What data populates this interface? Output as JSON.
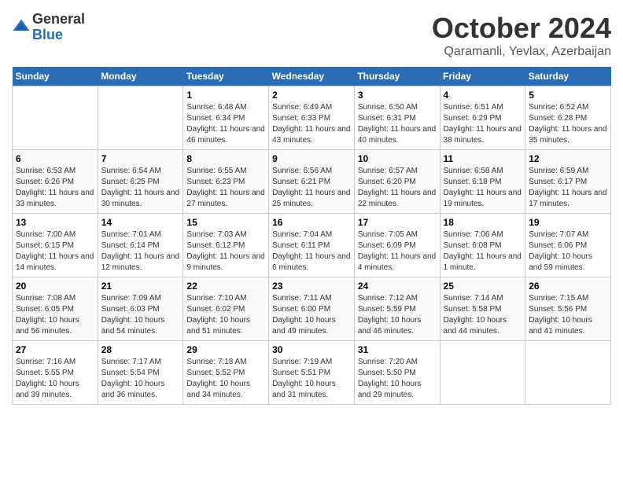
{
  "header": {
    "logo_line1": "General",
    "logo_line2": "Blue",
    "title": "October 2024",
    "subtitle": "Qaramanli, Yevlax, Azerbaijan"
  },
  "days_of_week": [
    "Sunday",
    "Monday",
    "Tuesday",
    "Wednesday",
    "Thursday",
    "Friday",
    "Saturday"
  ],
  "weeks": [
    [
      {
        "num": "",
        "info": ""
      },
      {
        "num": "",
        "info": ""
      },
      {
        "num": "1",
        "info": "Sunrise: 6:48 AM\nSunset: 6:34 PM\nDaylight: 11 hours and 46 minutes."
      },
      {
        "num": "2",
        "info": "Sunrise: 6:49 AM\nSunset: 6:33 PM\nDaylight: 11 hours and 43 minutes."
      },
      {
        "num": "3",
        "info": "Sunrise: 6:50 AM\nSunset: 6:31 PM\nDaylight: 11 hours and 40 minutes."
      },
      {
        "num": "4",
        "info": "Sunrise: 6:51 AM\nSunset: 6:29 PM\nDaylight: 11 hours and 38 minutes."
      },
      {
        "num": "5",
        "info": "Sunrise: 6:52 AM\nSunset: 6:28 PM\nDaylight: 11 hours and 35 minutes."
      }
    ],
    [
      {
        "num": "6",
        "info": "Sunrise: 6:53 AM\nSunset: 6:26 PM\nDaylight: 11 hours and 33 minutes."
      },
      {
        "num": "7",
        "info": "Sunrise: 6:54 AM\nSunset: 6:25 PM\nDaylight: 11 hours and 30 minutes."
      },
      {
        "num": "8",
        "info": "Sunrise: 6:55 AM\nSunset: 6:23 PM\nDaylight: 11 hours and 27 minutes."
      },
      {
        "num": "9",
        "info": "Sunrise: 6:56 AM\nSunset: 6:21 PM\nDaylight: 11 hours and 25 minutes."
      },
      {
        "num": "10",
        "info": "Sunrise: 6:57 AM\nSunset: 6:20 PM\nDaylight: 11 hours and 22 minutes."
      },
      {
        "num": "11",
        "info": "Sunrise: 6:58 AM\nSunset: 6:18 PM\nDaylight: 11 hours and 19 minutes."
      },
      {
        "num": "12",
        "info": "Sunrise: 6:59 AM\nSunset: 6:17 PM\nDaylight: 11 hours and 17 minutes."
      }
    ],
    [
      {
        "num": "13",
        "info": "Sunrise: 7:00 AM\nSunset: 6:15 PM\nDaylight: 11 hours and 14 minutes."
      },
      {
        "num": "14",
        "info": "Sunrise: 7:01 AM\nSunset: 6:14 PM\nDaylight: 11 hours and 12 minutes."
      },
      {
        "num": "15",
        "info": "Sunrise: 7:03 AM\nSunset: 6:12 PM\nDaylight: 11 hours and 9 minutes."
      },
      {
        "num": "16",
        "info": "Sunrise: 7:04 AM\nSunset: 6:11 PM\nDaylight: 11 hours and 6 minutes."
      },
      {
        "num": "17",
        "info": "Sunrise: 7:05 AM\nSunset: 6:09 PM\nDaylight: 11 hours and 4 minutes."
      },
      {
        "num": "18",
        "info": "Sunrise: 7:06 AM\nSunset: 6:08 PM\nDaylight: 11 hours and 1 minute."
      },
      {
        "num": "19",
        "info": "Sunrise: 7:07 AM\nSunset: 6:06 PM\nDaylight: 10 hours and 59 minutes."
      }
    ],
    [
      {
        "num": "20",
        "info": "Sunrise: 7:08 AM\nSunset: 6:05 PM\nDaylight: 10 hours and 56 minutes."
      },
      {
        "num": "21",
        "info": "Sunrise: 7:09 AM\nSunset: 6:03 PM\nDaylight: 10 hours and 54 minutes."
      },
      {
        "num": "22",
        "info": "Sunrise: 7:10 AM\nSunset: 6:02 PM\nDaylight: 10 hours and 51 minutes."
      },
      {
        "num": "23",
        "info": "Sunrise: 7:11 AM\nSunset: 6:00 PM\nDaylight: 10 hours and 49 minutes."
      },
      {
        "num": "24",
        "info": "Sunrise: 7:12 AM\nSunset: 5:59 PM\nDaylight: 10 hours and 46 minutes."
      },
      {
        "num": "25",
        "info": "Sunrise: 7:14 AM\nSunset: 5:58 PM\nDaylight: 10 hours and 44 minutes."
      },
      {
        "num": "26",
        "info": "Sunrise: 7:15 AM\nSunset: 5:56 PM\nDaylight: 10 hours and 41 minutes."
      }
    ],
    [
      {
        "num": "27",
        "info": "Sunrise: 7:16 AM\nSunset: 5:55 PM\nDaylight: 10 hours and 39 minutes."
      },
      {
        "num": "28",
        "info": "Sunrise: 7:17 AM\nSunset: 5:54 PM\nDaylight: 10 hours and 36 minutes."
      },
      {
        "num": "29",
        "info": "Sunrise: 7:18 AM\nSunset: 5:52 PM\nDaylight: 10 hours and 34 minutes."
      },
      {
        "num": "30",
        "info": "Sunrise: 7:19 AM\nSunset: 5:51 PM\nDaylight: 10 hours and 31 minutes."
      },
      {
        "num": "31",
        "info": "Sunrise: 7:20 AM\nSunset: 5:50 PM\nDaylight: 10 hours and 29 minutes."
      },
      {
        "num": "",
        "info": ""
      },
      {
        "num": "",
        "info": ""
      }
    ]
  ]
}
